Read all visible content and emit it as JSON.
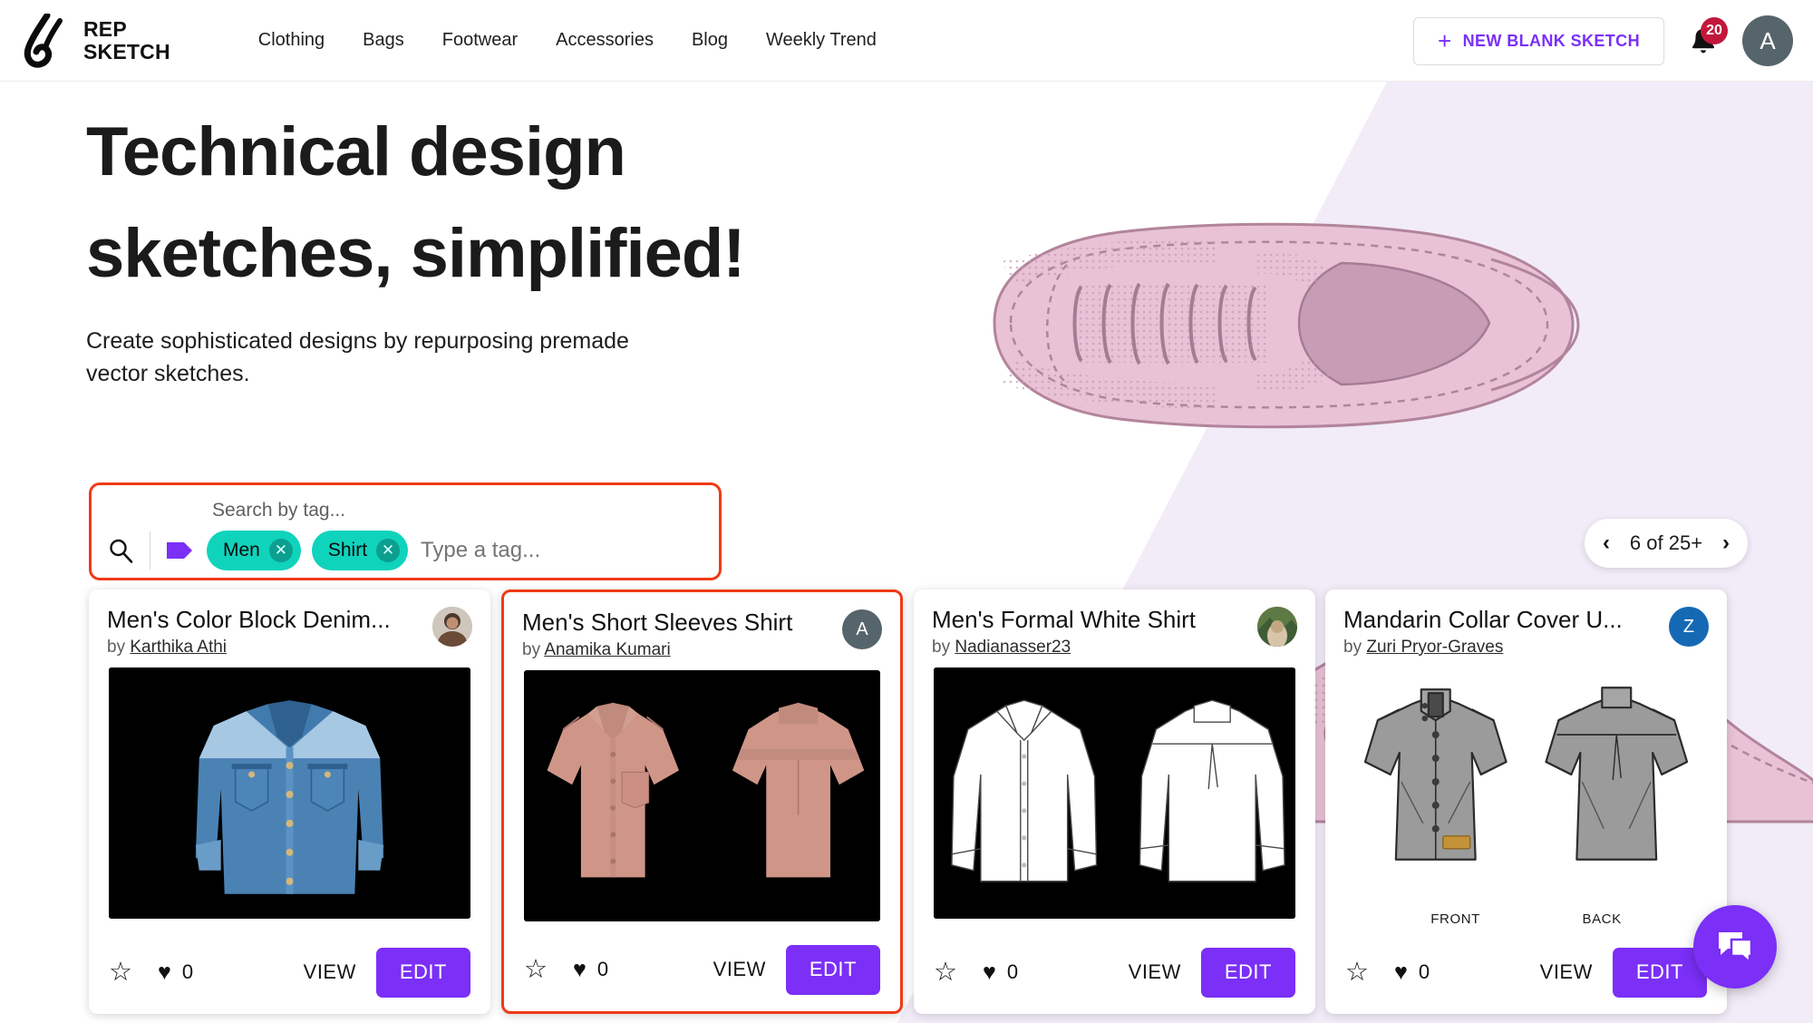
{
  "header": {
    "brand": {
      "line1": "REP",
      "line2": "SKETCH",
      "logo_icon": "repsketch-logo-icon"
    },
    "nav": [
      {
        "label": "Clothing"
      },
      {
        "label": "Bags"
      },
      {
        "label": "Footwear"
      },
      {
        "label": "Accessories"
      },
      {
        "label": "Blog"
      },
      {
        "label": "Weekly Trend"
      }
    ],
    "new_sketch_label": "NEW BLANK SKETCH",
    "plus_icon": "plus-icon",
    "bell_icon": "bell-icon",
    "notification_count": "20",
    "avatar_initial": "A"
  },
  "hero": {
    "title_line1": "Technical design",
    "title_line2": "sketches, simplified!",
    "subtitle_line1": "Create sophisticated designs by repurposing premade",
    "subtitle_line2": "vector sketches.",
    "background_color": "#f2ecf8",
    "illustration": "sneaker-illustration"
  },
  "search": {
    "label": "Search by tag...",
    "search_icon": "search-icon",
    "tag_icon": "tag-icon",
    "placeholder": "Type a tag...",
    "value": "",
    "chips": [
      {
        "label": "Men",
        "remove_icon": "close-icon"
      },
      {
        "label": "Shirt",
        "remove_icon": "close-icon"
      }
    ],
    "highlight_color": "#f03a17",
    "chip_color": "#10d3bc"
  },
  "pagination": {
    "prev_icon": "chevron-left-icon",
    "next_icon": "chevron-right-icon",
    "label": "6 of 25+"
  },
  "cards": [
    {
      "title": "Men's Color Block Denim...",
      "by_prefix": "by ",
      "author": "Karthika Athi",
      "avatar_type": "photo",
      "avatar_initial": "",
      "avatar_color": "#b4a79c",
      "likes": "0",
      "view_label": "VIEW",
      "edit_label": "EDIT",
      "star_icon": "star-outline-icon",
      "heart_icon": "heart-filled-icon",
      "image": "denim-color-block-shirt",
      "image_bg": "#000000",
      "selected": false,
      "front_label": "",
      "back_label": ""
    },
    {
      "title": "Men's Short Sleeves Shirt",
      "by_prefix": "by ",
      "author": "Anamika Kumari",
      "avatar_type": "initial",
      "avatar_initial": "A",
      "avatar_color": "#56646b",
      "likes": "0",
      "view_label": "VIEW",
      "edit_label": "EDIT",
      "star_icon": "star-outline-icon",
      "heart_icon": "heart-filled-icon",
      "image": "pink-short-sleeve-shirt",
      "image_bg": "#000000",
      "selected": true,
      "front_label": "",
      "back_label": ""
    },
    {
      "title": "Men's Formal White Shirt",
      "by_prefix": "by ",
      "author": "Nadianasser23",
      "avatar_type": "photo",
      "avatar_initial": "",
      "avatar_color": "#6d7a4a",
      "likes": "0",
      "view_label": "VIEW",
      "edit_label": "EDIT",
      "star_icon": "star-outline-icon",
      "heart_icon": "heart-filled-icon",
      "image": "white-formal-shirt",
      "image_bg": "#000000",
      "selected": false,
      "front_label": "",
      "back_label": ""
    },
    {
      "title": "Mandarin Collar Cover U...",
      "by_prefix": "by ",
      "author": "Zuri Pryor-Graves",
      "avatar_type": "initial",
      "avatar_initial": "Z",
      "avatar_color": "#1569b4",
      "likes": "0",
      "view_label": "VIEW",
      "edit_label": "EDIT",
      "star_icon": "star-outline-icon",
      "heart_icon": "heart-filled-icon",
      "image": "grey-mandarin-collar-shirt",
      "image_bg": "#ffffff",
      "selected": false,
      "front_label": "FRONT",
      "back_label": "BACK"
    }
  ],
  "fab": {
    "icon": "chat-bubble-icon"
  },
  "theme": {
    "accent": "#7b2ff7",
    "badge": "#c2173b",
    "highlight": "#f03a17"
  }
}
